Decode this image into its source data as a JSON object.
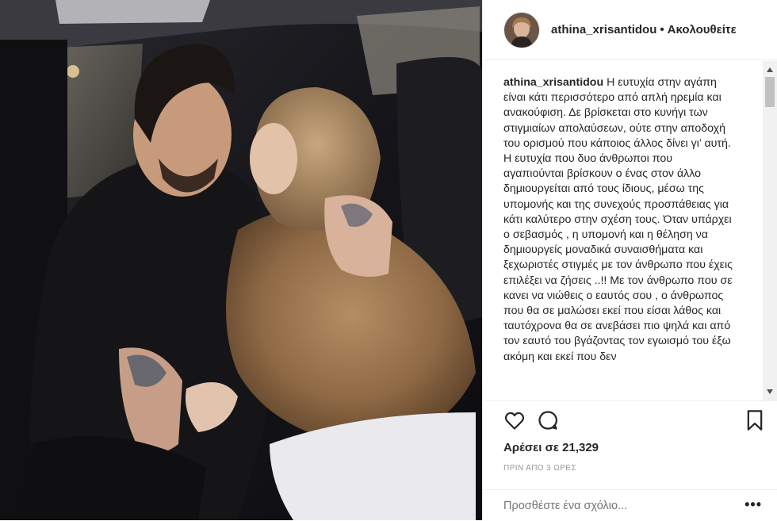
{
  "post": {
    "username": "athina_xrisantidou",
    "separator": "•",
    "follow_status": "Ακολουθείτε",
    "caption": "Η ευτυχία στην αγάπη είναι κάτι περισσότερο από απλή ηρεμία και ανακούφιση. Δε βρίσκεται στο κυνήγι των στιγμιαίων απολαύσεων, ούτε στην αποδοχή του ορισμού που κάποιος άλλος δίνει γι’ αυτή. Η ευτυχία που δυο άνθρωποι που αγαπιούνται βρίσκουν ο ένας στον άλλο δημιουργείται από τους ίδιους, μέσω της υπομονής και της συνεχούς προσπάθειας για κάτι καλύτερο στην σχέση τους. Όταν υπάρχει ο σεβασμός , η υπομονή και η θέληση να δημιουργείς μοναδικά συναισθήματα και ξεχωριστές στιγμές με τον άνθρωπο που έχεις επιλέξει να ζήσεις ..!! Με τον άνθρωπο που σε κανει να νιώθεις ο εαυτός σου , ο άνθρωπος που θα σε μαλώσει εκεί που είσαι λάθος και ταυτόχρονα θα σε ανεβάσει πιο ψηλά και από τον εαυτό του βγάζοντας τον εγωισμό του έξω ακόμη και εκεί που δεν",
    "likes_text": "Αρέσει σε 21,329",
    "timestamp": "ΠΡΙΝ ΑΠΟ 3 ΩΡΕΣ",
    "comment_placeholder": "Προσθέστε ένα σχόλιο...",
    "more_label": "•••"
  },
  "icons": {
    "like": "heart-icon",
    "comment": "comment-bubble-icon",
    "save": "bookmark-icon",
    "more": "more-options-icon"
  },
  "colors": {
    "text": "#262626",
    "muted": "#999999",
    "divider": "#efefef"
  }
}
